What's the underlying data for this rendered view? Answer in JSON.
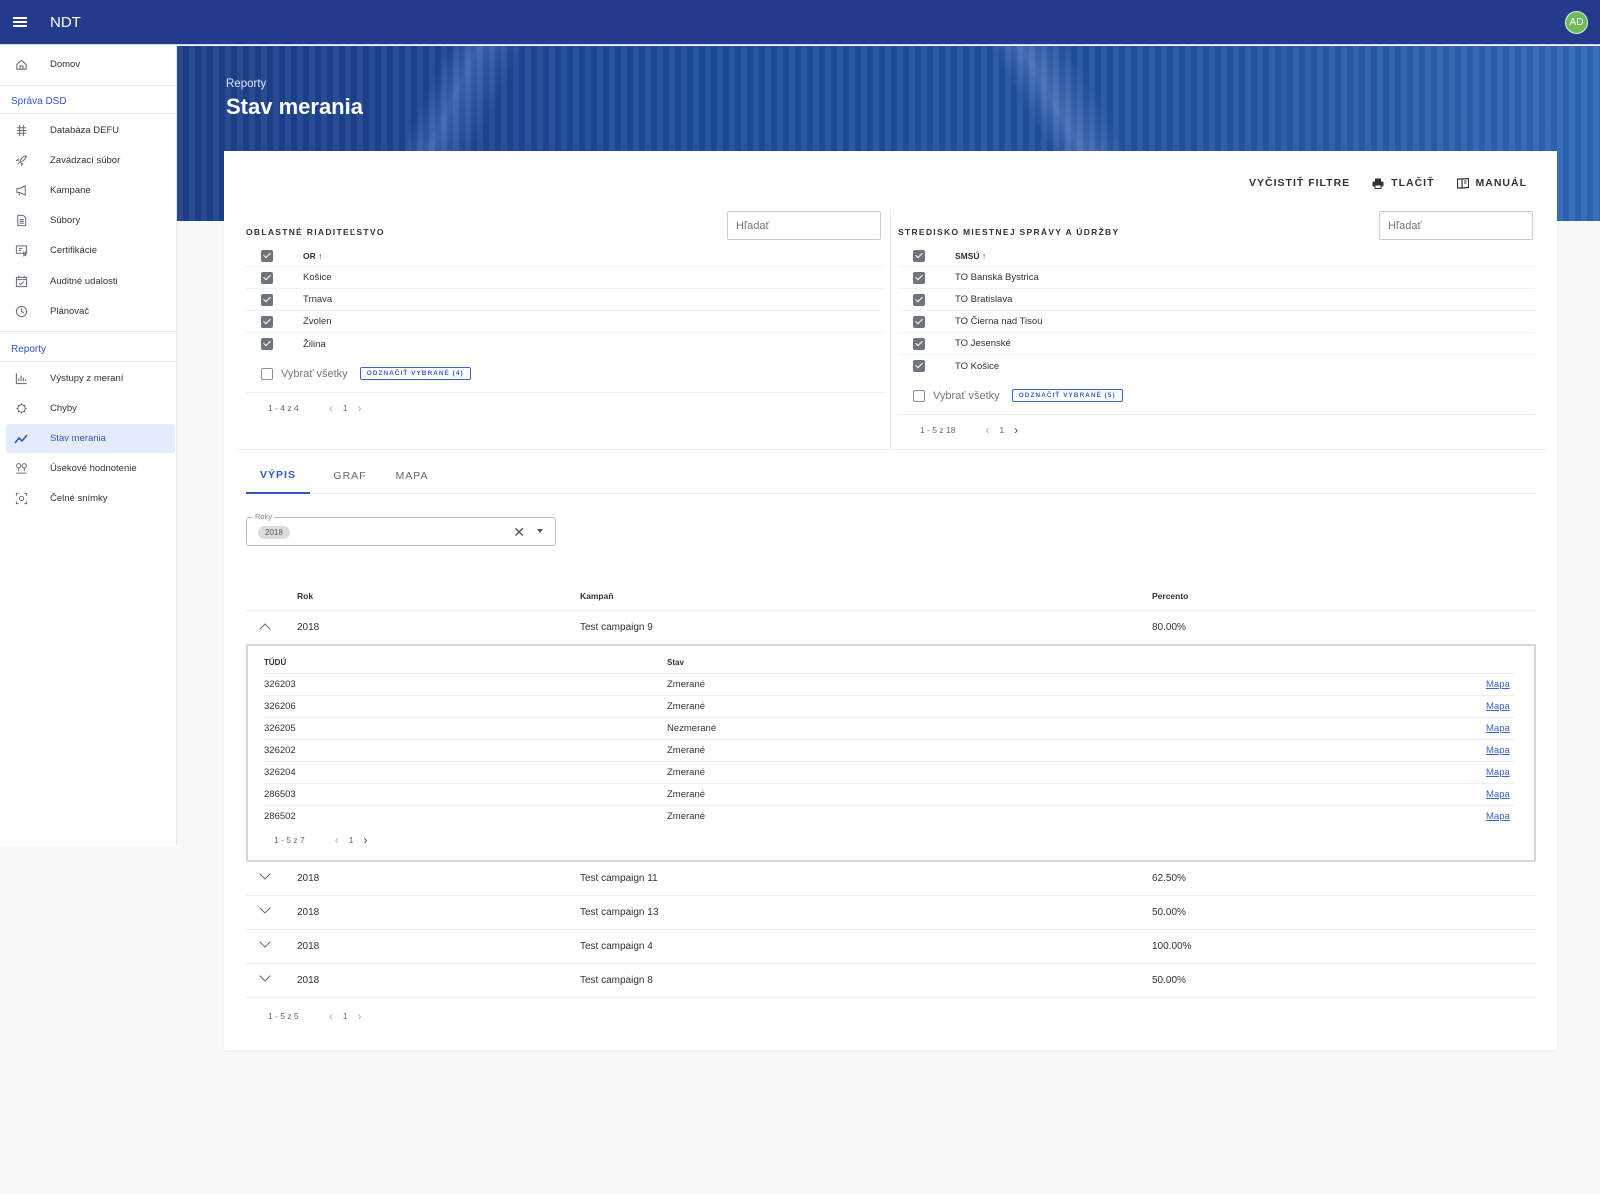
{
  "app": {
    "title": "NDT",
    "avatar": "AD"
  },
  "sidebar": {
    "home": "Domov",
    "section1": "Správa DSD",
    "items1": [
      "Databáza DEFU",
      "Zavádzací súbor",
      "Kampane",
      "Súbory",
      "Certifikácie",
      "Auditné udalosti",
      "Plánovač"
    ],
    "section2": "Reporty",
    "items2": [
      "Výstupy z meraní",
      "Chyby",
      "Stav merania",
      "Úsekové hodnotenie",
      "Čelné snímky"
    ]
  },
  "header": {
    "breadcrumb": "Reporty",
    "title": "Stav merania"
  },
  "actions": {
    "clear": "VYČISTIŤ FILTRE",
    "print": "TLAČIŤ",
    "manual": "MANUÁL"
  },
  "or_panel": {
    "title": "OBLASTNÉ RIADITEĽSTVO",
    "search_placeholder": "Hľadať",
    "column": "OR",
    "rows": [
      "Košice",
      "Trnava",
      "Zvolen",
      "Žilina"
    ],
    "select_all": "Vybrať všetky",
    "unselect": "ODZNAČIŤ VYBRANÉ (4)",
    "range": "1 - 4 z 4",
    "page": "1"
  },
  "smsu_panel": {
    "title": "STREDISKO MIESTNEJ SPRÁVY A ÚDRŽBY",
    "search_placeholder": "Hľadať",
    "column": "SMSÚ",
    "rows": [
      "TO Banská Bystrica",
      "TO Bratislava",
      "TO Čierna nad Tisou",
      "TO Jesenské",
      "TO Košice"
    ],
    "select_all": "Vybrať všetky",
    "unselect": "ODZNAČIŤ VYBRANÉ (5)",
    "range": "1 - 5 z 18",
    "page": "1"
  },
  "tabs": [
    "VÝPIS",
    "GRAF",
    "MAPA"
  ],
  "filter": {
    "label": "Roky",
    "chip": "2018"
  },
  "table": {
    "headers": {
      "year": "Rok",
      "campaign": "Kampaň",
      "percent": "Percento"
    },
    "rows": [
      {
        "year": "2018",
        "campaign": "Test campaign 9",
        "percent": "80.00%"
      },
      {
        "year": "2018",
        "campaign": "Test campaign 11",
        "percent": "62.50%"
      },
      {
        "year": "2018",
        "campaign": "Test campaign 13",
        "percent": "50.00%"
      },
      {
        "year": "2018",
        "campaign": "Test campaign 4",
        "percent": "100.00%"
      },
      {
        "year": "2018",
        "campaign": "Test campaign 8",
        "percent": "50.00%"
      }
    ],
    "range": "1 - 5 z 5",
    "page": "1"
  },
  "detail": {
    "headers": {
      "tudu": "TÚDÚ",
      "state": "Stav"
    },
    "rows": [
      {
        "tudu": "326203",
        "state": "Zmerané",
        "link": "Mapa"
      },
      {
        "tudu": "326206",
        "state": "Zmerané",
        "link": "Mapa"
      },
      {
        "tudu": "326205",
        "state": "Nezmerané",
        "link": "Mapa"
      },
      {
        "tudu": "326202",
        "state": "Zmerané",
        "link": "Mapa"
      },
      {
        "tudu": "326204",
        "state": "Zmerané",
        "link": "Mapa"
      },
      {
        "tudu": "286503",
        "state": "Zmerané",
        "link": "Mapa"
      },
      {
        "tudu": "286502",
        "state": "Zmerané",
        "link": "Mapa"
      }
    ],
    "range": "1 - 5 z 7",
    "page": "1"
  }
}
